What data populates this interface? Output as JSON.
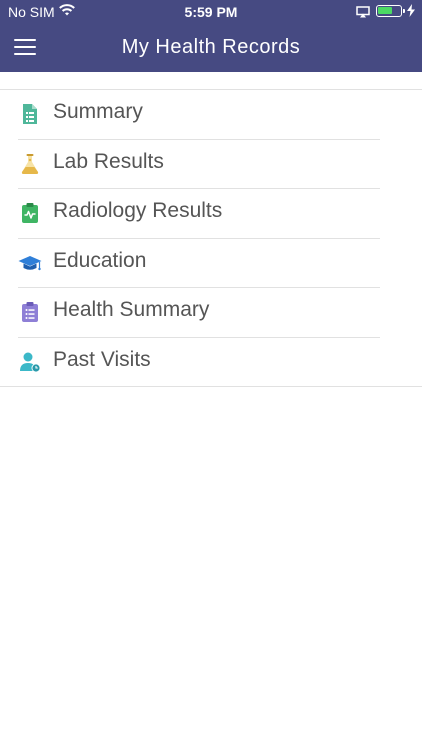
{
  "status_bar": {
    "carrier": "No SIM",
    "time": "5:59 PM",
    "battery_color": "#4cd964"
  },
  "header": {
    "title": "My Health Records",
    "background_color": "#464a82"
  },
  "menu": {
    "items": [
      {
        "label": "Summary",
        "icon": "document-list-icon",
        "icon_color": "#4fb79a"
      },
      {
        "label": "Lab Results",
        "icon": "flask-icon",
        "icon_color": "#e6b84a"
      },
      {
        "label": "Radiology Results",
        "icon": "clipboard-pulse-icon",
        "icon_color": "#3fb564"
      },
      {
        "label": "Education",
        "icon": "graduation-cap-icon",
        "icon_color": "#2f7fd8"
      },
      {
        "label": "Health Summary",
        "icon": "clipboard-list-icon",
        "icon_color": "#8e7fd6"
      },
      {
        "label": "Past Visits",
        "icon": "user-clock-icon",
        "icon_color": "#3bb8c8"
      }
    ]
  }
}
